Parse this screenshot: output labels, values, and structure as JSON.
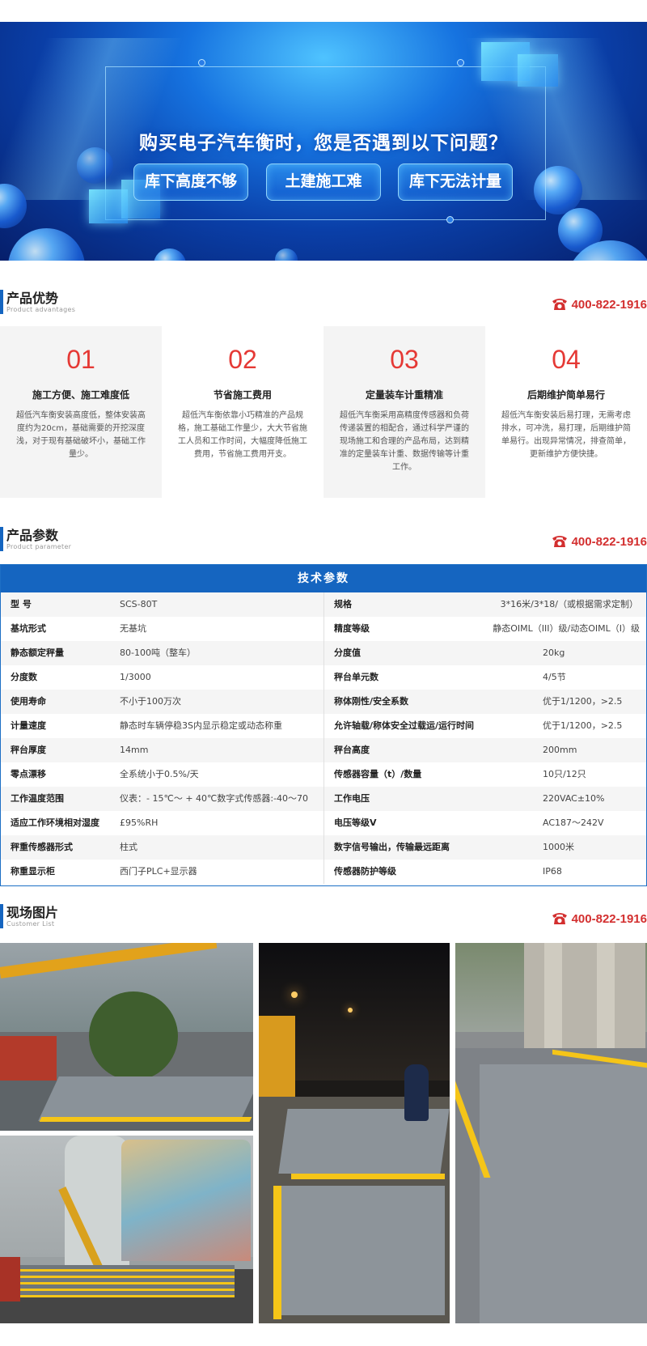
{
  "banner": {
    "headline": "购买电子汽车衡时，您是否遇到以下问题？",
    "tags": [
      "库下高度不够",
      "土建施工难",
      "库下无法计量"
    ]
  },
  "contact": {
    "phone": "400-822-1916",
    "phone_icon": "telephone-icon",
    "phone_color": "#d32f2f"
  },
  "advantages": {
    "title": "产品优势",
    "subtitle": "Product advantages",
    "items": [
      {
        "num": "01",
        "title": "施工方便、施工难度低",
        "desc": "超低汽车衡安装高度低，整体安装高度约为20cm，基础需要的开挖深度浅，对于现有基础破坏小，基础工作量少。"
      },
      {
        "num": "02",
        "title": "节省施工费用",
        "desc": "超低汽车衡依靠小巧精准的产品规格，施工基础工作量少，大大节省施工人员和工作时间，大幅度降低施工费用，节省施工费用开支。"
      },
      {
        "num": "03",
        "title": "定量装车计重精准",
        "desc": "超低汽车衡采用高精度传感器和负荷传递装置的相配合，通过科学严谨的现场施工和合理的产品布局，达到精准的定量装车计重、数据传输等计重工作。"
      },
      {
        "num": "04",
        "title": "后期维护简单易行",
        "desc": "超低汽车衡安装后易打理，无需考虑排水，可冲洗，易打理，后期维护简单易行。出现异常情况，排查简单，更新维护方便快捷。"
      }
    ]
  },
  "params": {
    "title": "产品参数",
    "subtitle": "Product parameter",
    "table_title": "技术参数",
    "rows": [
      {
        "k1": "型 号",
        "v1": "SCS-80T",
        "k2": "规格",
        "v2": "3*16米/3*18/（或根据需求定制）"
      },
      {
        "k1": "基坑形式",
        "v1": "无基坑",
        "k2": "精度等级",
        "v2": "静态OIML（III）级/动态OIML（I）级"
      },
      {
        "k1": "静态额定秤量",
        "v1": "80-100吨（整车）",
        "k2": "分度值",
        "v2": "20kg"
      },
      {
        "k1": "分度数",
        "v1": "1/3000",
        "k2": "秤台单元数",
        "v2": "4/5节"
      },
      {
        "k1": "使用寿命",
        "v1": "不小于100万次",
        "k2": "称体刚性/安全系数",
        "v2": "优于1/1200，>2.5"
      },
      {
        "k1": "计量速度",
        "v1": "静态时车辆停稳3S内显示稳定或动态称重",
        "k2": "允许轴载/称体安全过载运/运行时间",
        "v2": "优于1/1200，>2.5"
      },
      {
        "k1": "秤台厚度",
        "v1": "14mm",
        "k2": "秤台高度",
        "v2": "200mm"
      },
      {
        "k1": "零点漂移",
        "v1": "全系统小于0.5%/天",
        "k2": "传感器容量（t）/数量",
        "v2": "10只/12只"
      },
      {
        "k1": "工作温度范围",
        "v1": "仪表：- 15℃～ + 40℃数字式传感器:-40～70",
        "k2": "工作电压",
        "v2": "220VAC±10%"
      },
      {
        "k1": "适应工作环境相对湿度",
        "v1": "£95%RH",
        "k2": "电压等级V",
        "v2": "AC187～242V"
      },
      {
        "k1": "秤重传感器形式",
        "v1": "柱式",
        "k2": "数字信号输出，传输最远距离",
        "v2": "1000米"
      },
      {
        "k1": "称重显示柜",
        "v1": "西门子PLC+显示器",
        "k2": "传感器防护等级",
        "v2": "IP68"
      }
    ]
  },
  "cases": {
    "title": "现场图片",
    "subtitle": "Customer List"
  },
  "colors": {
    "accent_blue": "#1565c0",
    "number_red": "#e53935",
    "rail_yellow": "#f5c518"
  }
}
